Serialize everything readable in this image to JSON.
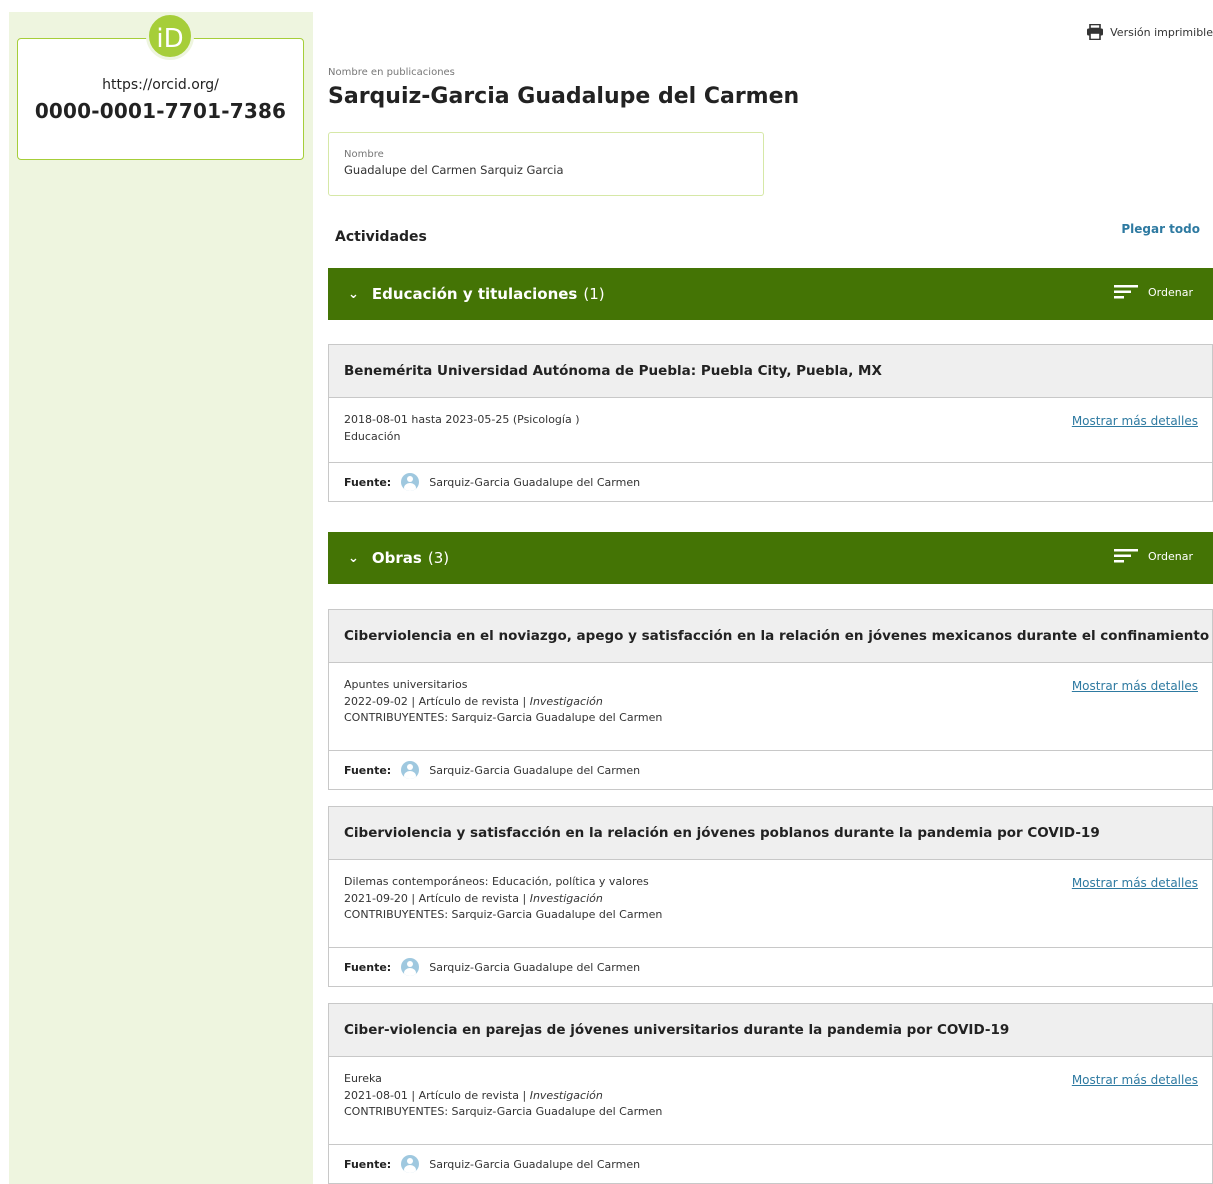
{
  "orcid": {
    "logo_text": "iD",
    "url": "https://orcid.org/",
    "id": "0000-0001-7701-7386"
  },
  "header": {
    "print_label": "Versión imprimible",
    "pub_name_label": "Nombre en publicaciones",
    "pub_name": "Sarquiz-Garcia Guadalupe del Carmen",
    "name_label": "Nombre",
    "name_value": "Guadalupe del Carmen Sarquiz Garcia"
  },
  "activities": {
    "title": "Actividades",
    "collapse_all": "Plegar todo"
  },
  "education": {
    "title": "Educación y titulaciones",
    "count": "(1)",
    "sort_label": "Ordenar",
    "items": [
      {
        "title": "Benemérita Universidad Autónoma de Puebla: Puebla City, Puebla, MX",
        "line1": "2018-08-01 hasta 2023-05-25 (Psicología )",
        "line2": "Educación",
        "details": "Mostrar más detalles",
        "source_label": "Fuente:",
        "source": "Sarquiz-Garcia Guadalupe del Carmen"
      }
    ]
  },
  "works": {
    "title": "Obras",
    "count": "(3)",
    "sort_label": "Ordenar",
    "items": [
      {
        "title": "Ciberviolencia en el noviazgo, apego y satisfacción en la relación en jóvenes mexicanos durante el confinamiento",
        "journal": "Apuntes universitarios",
        "date_type": "2022-09-02 | Artículo de revista | ",
        "category": "Investigación",
        "contributors": "CONTRIBUYENTES: Sarquiz-Garcia Guadalupe del Carmen",
        "details": "Mostrar más detalles",
        "source_label": "Fuente:",
        "source": "Sarquiz-Garcia Guadalupe del Carmen"
      },
      {
        "title": "Ciberviolencia y satisfacción en la relación en jóvenes poblanos durante la pandemia por COVID-19",
        "journal": "Dilemas contemporáneos: Educación, política y valores",
        "date_type": "2021-09-20 | Artículo de revista | ",
        "category": "Investigación",
        "contributors": "CONTRIBUYENTES: Sarquiz-Garcia Guadalupe del Carmen",
        "details": "Mostrar más detalles",
        "source_label": "Fuente:",
        "source": "Sarquiz-Garcia Guadalupe del Carmen"
      },
      {
        "title": "Ciber-violencia en parejas de jóvenes universitarios durante la pandemia por COVID-19",
        "journal": "Eureka",
        "date_type": "2021-08-01 | Artículo de revista | ",
        "category": "Investigación",
        "contributors": "CONTRIBUYENTES: Sarquiz-Garcia Guadalupe del Carmen",
        "details": "Mostrar más detalles",
        "source_label": "Fuente:",
        "source": "Sarquiz-Garcia Guadalupe del Carmen"
      }
    ]
  },
  "colors": {
    "orcid_green": "#a6ce39",
    "section_bar": "#447405",
    "sidebar_bg": "#eef5df",
    "link": "#2e7aa1"
  }
}
